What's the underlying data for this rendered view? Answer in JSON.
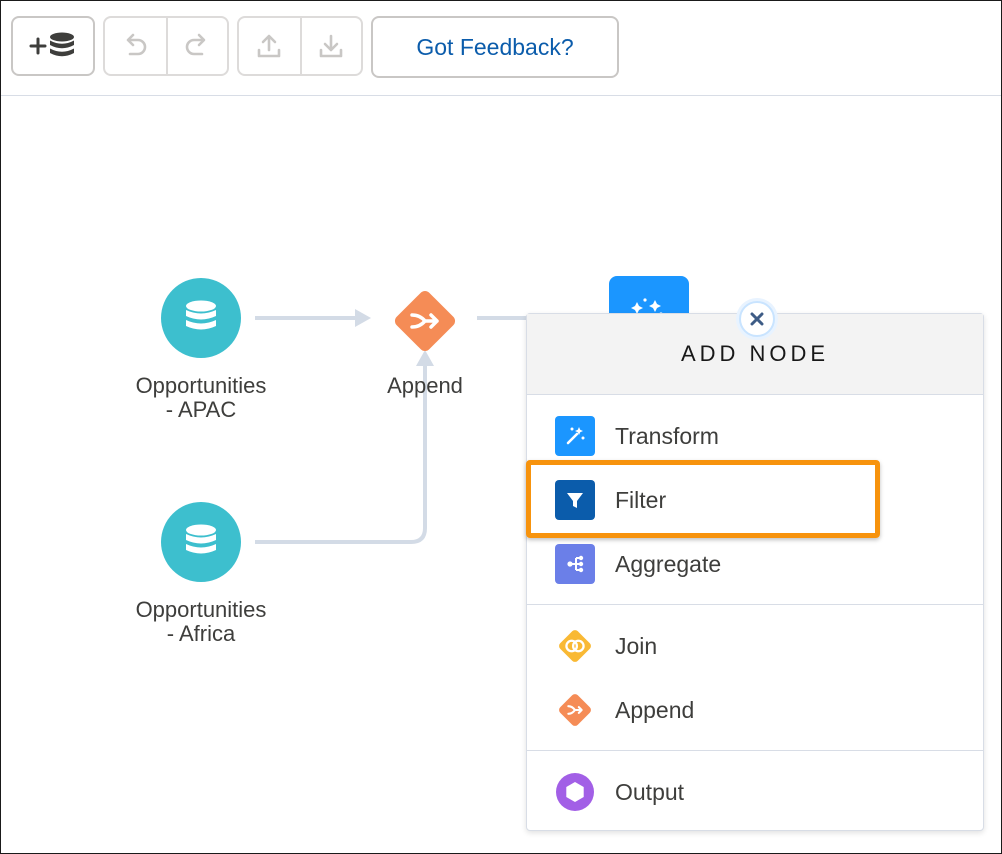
{
  "toolbar": {
    "add_dataset_icon": "add-database-icon",
    "undo_icon": "undo-icon",
    "redo_icon": "redo-icon",
    "upload_icon": "upload-icon",
    "download_icon": "download-icon",
    "feedback_label": "Got Feedback?"
  },
  "canvas": {
    "nodes": [
      {
        "label_line1": "Opportunities",
        "label_line2": "- APAC",
        "icon": "database-icon"
      },
      {
        "label": "Append",
        "icon": "append-icon"
      },
      {
        "label_line1": "Opportunities",
        "label_line2": "- Africa",
        "icon": "database-icon"
      },
      {
        "icon": "transform-sparkle-icon"
      }
    ]
  },
  "add_node_menu": {
    "title": "ADD NODE",
    "items": [
      {
        "label": "Transform",
        "icon": "transform-icon",
        "color": "#1b96ff"
      },
      {
        "label": "Filter",
        "icon": "filter-icon",
        "color": "#0b5cab"
      },
      {
        "label": "Aggregate",
        "icon": "aggregate-icon",
        "color": "#6b7fe8"
      },
      {
        "label": "Join",
        "icon": "join-icon",
        "color": "#f9b934"
      },
      {
        "label": "Append",
        "icon": "append-icon",
        "color": "#f58c56"
      },
      {
        "label": "Output",
        "icon": "output-icon",
        "color": "#a25fe6"
      }
    ],
    "highlighted_item": "Filter"
  },
  "colors": {
    "database_node": "#3dbfce",
    "append_node": "#f58c56",
    "transform_node": "#1b96ff",
    "highlight": "#f7930d",
    "connector": "#d3dbe6"
  }
}
